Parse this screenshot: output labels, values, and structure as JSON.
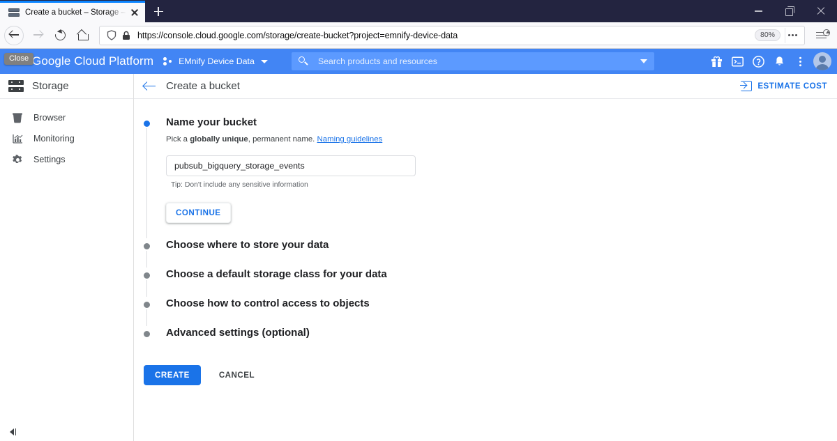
{
  "browser": {
    "tab": {
      "title": "Create a bucket – Storage – EMnify Device Data",
      "favicon_icon": "storage-bucket-favicon",
      "close_icon": "close-icon"
    },
    "new_tab_icon": "plus-icon",
    "window_controls": {
      "minimize_icon": "minimize-icon",
      "maximize_icon": "restore-window-icon",
      "close_icon": "close-window-icon"
    },
    "nav": {
      "back_icon": "back-arrow-icon",
      "forward_icon": "forward-arrow-icon",
      "reload_icon": "reload-icon",
      "home_icon": "home-icon"
    },
    "address": {
      "shield_icon": "tracking-protection-shield-icon",
      "lock_icon": "padlock-icon",
      "url": "https://console.cloud.google.com/storage/create-bucket?project=emnify-device-data",
      "zoom_level": "80%",
      "more_icon": "page-actions-ellipsis-icon"
    },
    "library_icon": "library-downloads-icon"
  },
  "overlay": {
    "close_label": "Close"
  },
  "gcp_header": {
    "brand": "Google Cloud Platform",
    "project_icon": "project-selector-icon",
    "project_name": "EMnify Device Data",
    "project_caret_icon": "chevron-down-icon",
    "search": {
      "icon": "search-icon",
      "placeholder": "Search products and resources",
      "caret_icon": "chevron-down-icon"
    },
    "icons": [
      {
        "name": "gift-icon"
      },
      {
        "name": "cloud-shell-icon"
      },
      {
        "name": "help-icon"
      },
      {
        "name": "notifications-bell-icon"
      },
      {
        "name": "more-vertical-icon"
      },
      {
        "name": "avatar"
      }
    ]
  },
  "sidebar": {
    "title": "Storage",
    "title_icon": "storage-icon",
    "items": [
      {
        "label": "Browser",
        "icon": "bucket-icon"
      },
      {
        "label": "Monitoring",
        "icon": "monitoring-chart-icon"
      },
      {
        "label": "Settings",
        "icon": "gear-icon"
      }
    ],
    "collapse_icon": "collapse-panel-icon"
  },
  "page": {
    "back_icon": "back-arrow-icon",
    "title": "Create a bucket",
    "estimate_cost": {
      "label": "ESTIMATE COST",
      "icon": "estimate-cost-icon"
    }
  },
  "form": {
    "steps": [
      {
        "title": "Name your bucket",
        "state": "active",
        "helper_prefix": "Pick a ",
        "helper_bold": "globally unique",
        "helper_suffix": ", permanent name. ",
        "helper_link": "Naming guidelines",
        "input_value": "pubsub_bigquery_storage_events",
        "input_placeholder": "",
        "tip": "Tip: Don't include any sensitive information",
        "continue_label": "CONTINUE"
      },
      {
        "title": "Choose where to store your data",
        "state": "inactive"
      },
      {
        "title": "Choose a default storage class for your data",
        "state": "inactive"
      },
      {
        "title": "Choose how to control access to objects",
        "state": "inactive"
      },
      {
        "title": "Advanced settings (optional)",
        "state": "inactive"
      }
    ],
    "create_label": "CREATE",
    "cancel_label": "CANCEL"
  },
  "colors": {
    "gcp_blue": "#4285f4",
    "accent_blue": "#1a73e8",
    "titlebar": "#232440",
    "tab_indicator": "#0a84ff"
  }
}
